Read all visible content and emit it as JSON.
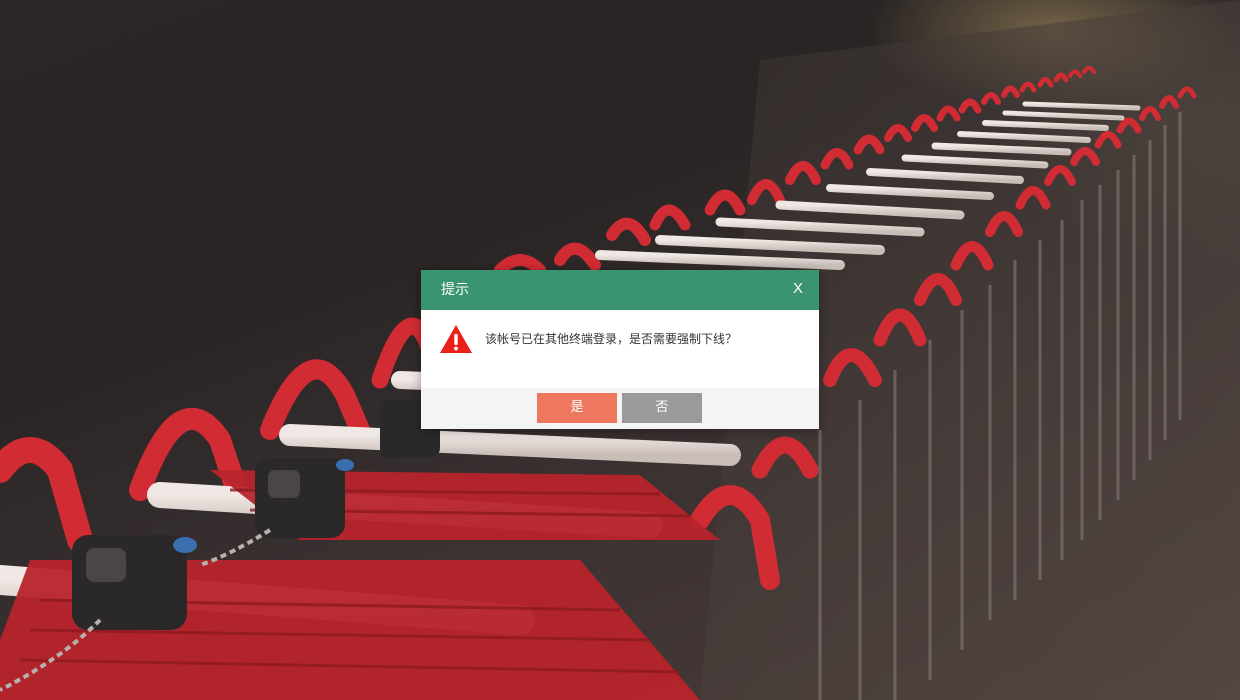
{
  "dialog": {
    "title": "提示",
    "close_label": "X",
    "message": "该帐号已在其他终端登录，是否需要强制下线？",
    "icon": "warning-icon",
    "buttons": {
      "yes_label": "是",
      "no_label": "否"
    }
  },
  "colors": {
    "header": "#3a9470",
    "yes_button": "#ee7760",
    "no_button": "#9a9a9a",
    "warning": "#e8221b"
  }
}
